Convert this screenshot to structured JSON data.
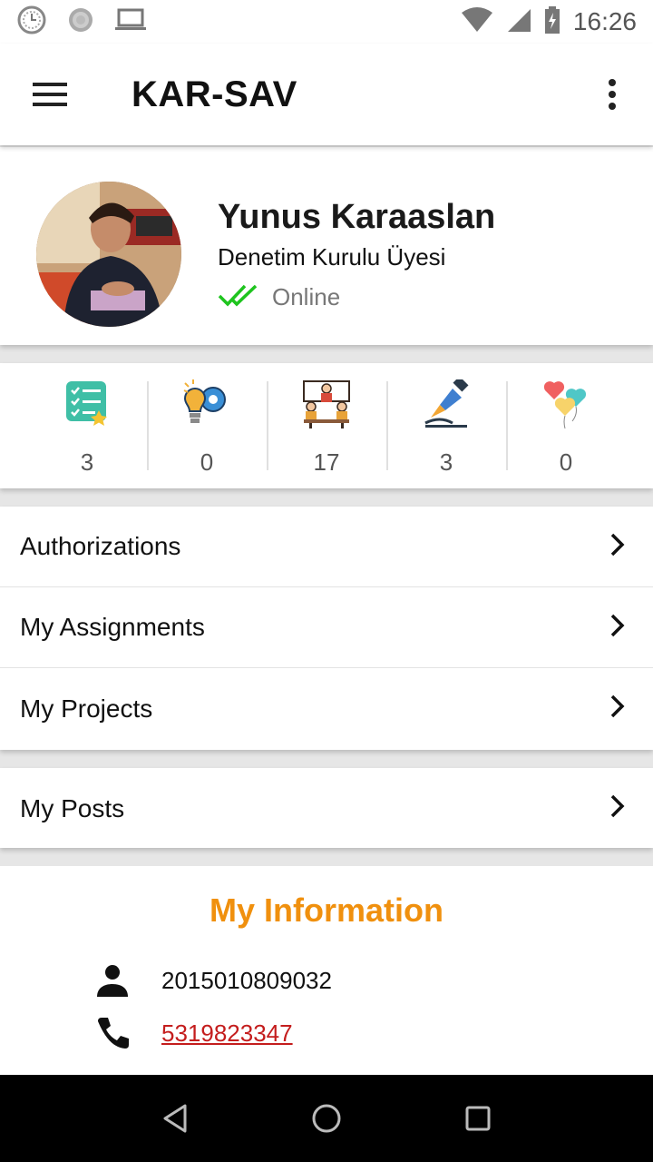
{
  "status_bar": {
    "time": "16:26",
    "icons": [
      "clock-icon",
      "settings-circle-icon",
      "laptop-icon",
      "wifi-icon",
      "signal-icon",
      "battery-charging-icon"
    ]
  },
  "app_bar": {
    "title": "KAR-SAV",
    "menu_icon": "hamburger-menu-icon",
    "more_icon": "more-vert-icon"
  },
  "profile": {
    "name": "Yunus Karaaslan",
    "role": "Denetim Kurulu Üyesi",
    "status": "Online",
    "status_color": "#1ec41e"
  },
  "stats": [
    {
      "icon": "checklist-star-icon",
      "value": "3"
    },
    {
      "icon": "lightbulb-gear-icon",
      "value": "0"
    },
    {
      "icon": "meeting-team-icon",
      "value": "17"
    },
    {
      "icon": "pen-nib-icon",
      "value": "3"
    },
    {
      "icon": "heart-balloons-icon",
      "value": "0"
    }
  ],
  "menu": {
    "group1": [
      {
        "label": "Authorizations"
      },
      {
        "label": "My Assignments"
      },
      {
        "label": "My Projects"
      }
    ],
    "group2": [
      {
        "label": "My Posts"
      }
    ]
  },
  "info": {
    "title": "My Information",
    "title_color": "#f0900e",
    "id_number": "2015010809032",
    "phone": "5319823347",
    "link_color": "#c41d1d"
  },
  "nav_bar": {
    "icons": [
      "back-triangle-icon",
      "home-circle-icon",
      "recents-square-icon"
    ]
  }
}
